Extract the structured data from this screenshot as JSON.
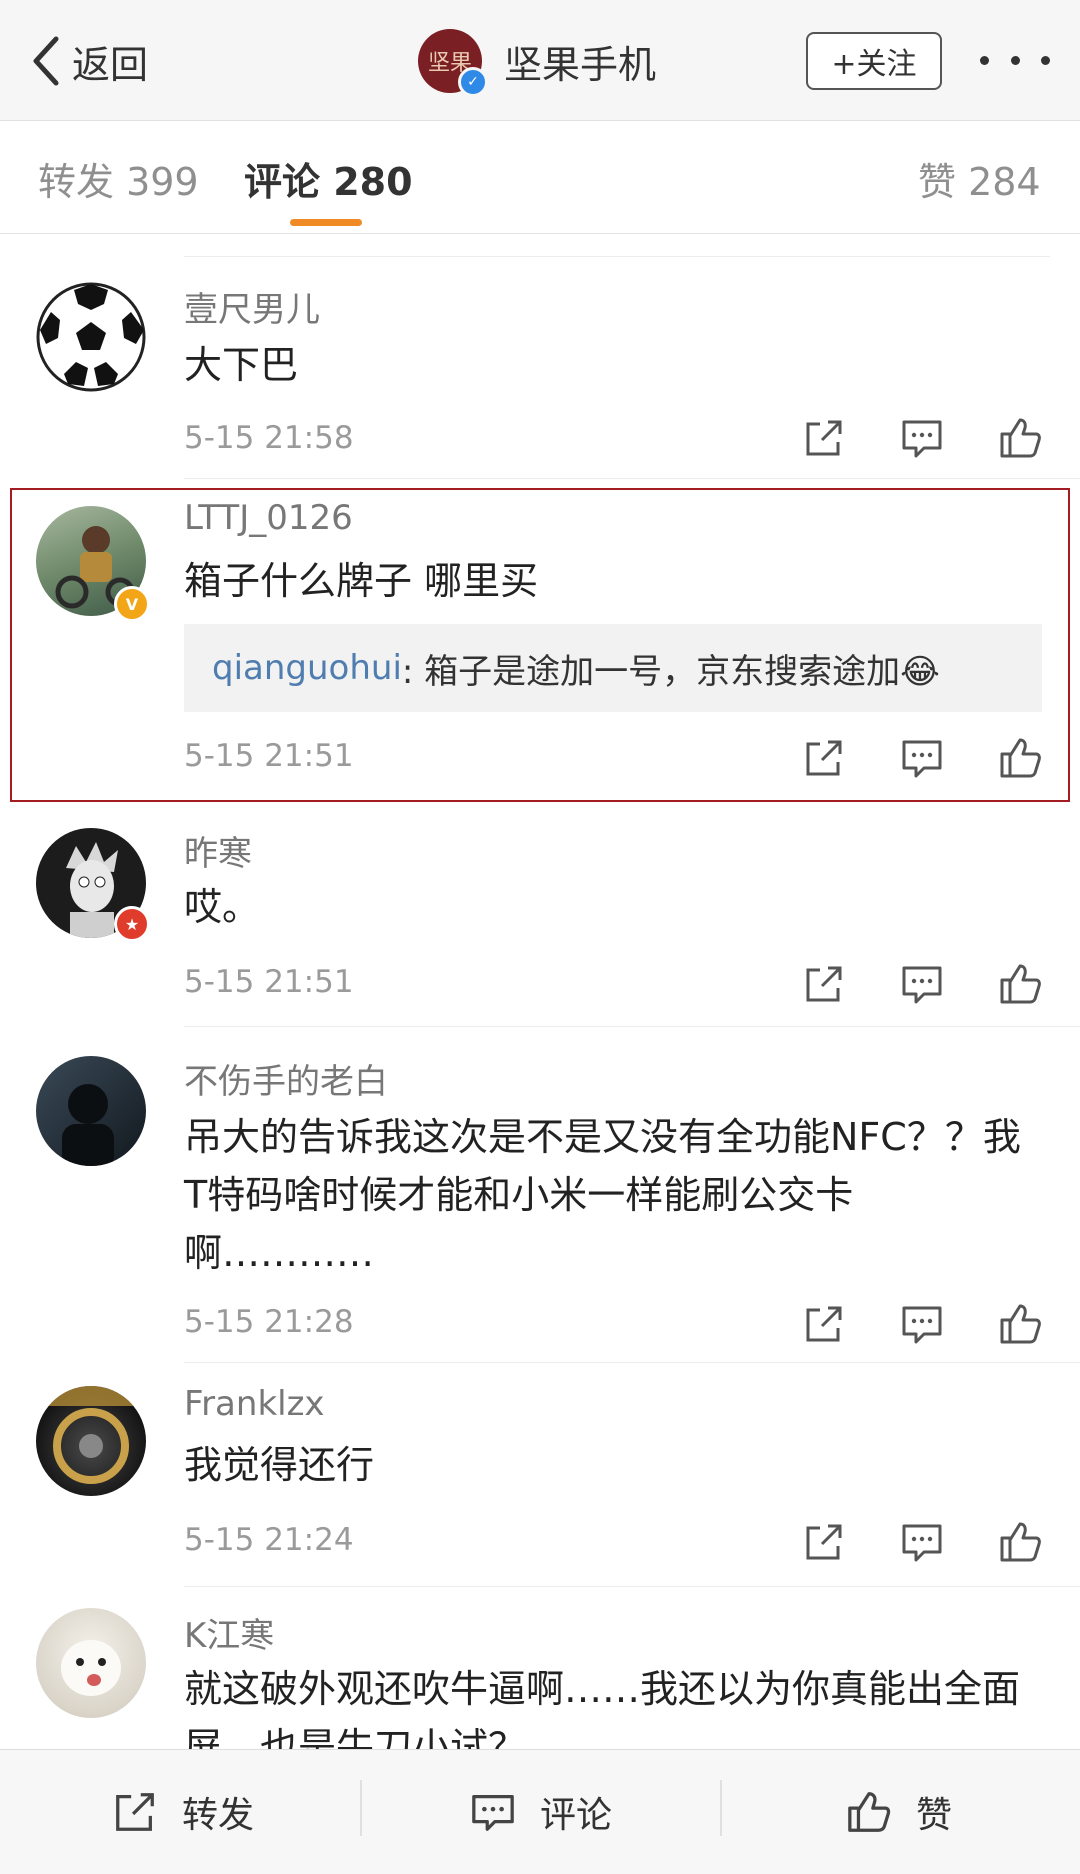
{
  "header": {
    "back_label": "返回",
    "title": "坚果手机",
    "logo_text": "坚果",
    "follow_label": "+关注"
  },
  "tabs": [
    {
      "label": "转发 399"
    },
    {
      "label": "评论 280"
    },
    {
      "label": "赞 284"
    }
  ],
  "comments": [
    {
      "name": "壹尺男儿",
      "text": "大下巴",
      "time": "5-15 21:58"
    },
    {
      "name": "LTTJ_0126",
      "text": "箱子什么牌子 哪里买",
      "time": "5-15 21:51",
      "reply": {
        "user": "qianguohui",
        "text": ": 箱子是途加一号，京东搜索途加😂"
      }
    },
    {
      "name": "昨寒",
      "text": "哎。",
      "time": "5-15 21:51"
    },
    {
      "name": "不伤手的老白",
      "text": "吊大的告诉我这次是不是又没有全功能NFC？？我T特码啥时候才能和小米一样能刷公交卡啊…………",
      "time": "5-15 21:28"
    },
    {
      "name": "Franklzx",
      "text": "我觉得还行",
      "time": "5-15 21:24"
    },
    {
      "name": "K江寒",
      "text": "就这破外观还吹牛逼啊……我还以为你真能出全面屏，也是牛刀小试？"
    }
  ],
  "bottom": {
    "repost_label": "转发",
    "comment_label": "评论",
    "like_label": "赞"
  },
  "colors": {
    "accent": "#f08a24",
    "highlight_border": "#a31c22",
    "reply_user": "#507daf"
  }
}
